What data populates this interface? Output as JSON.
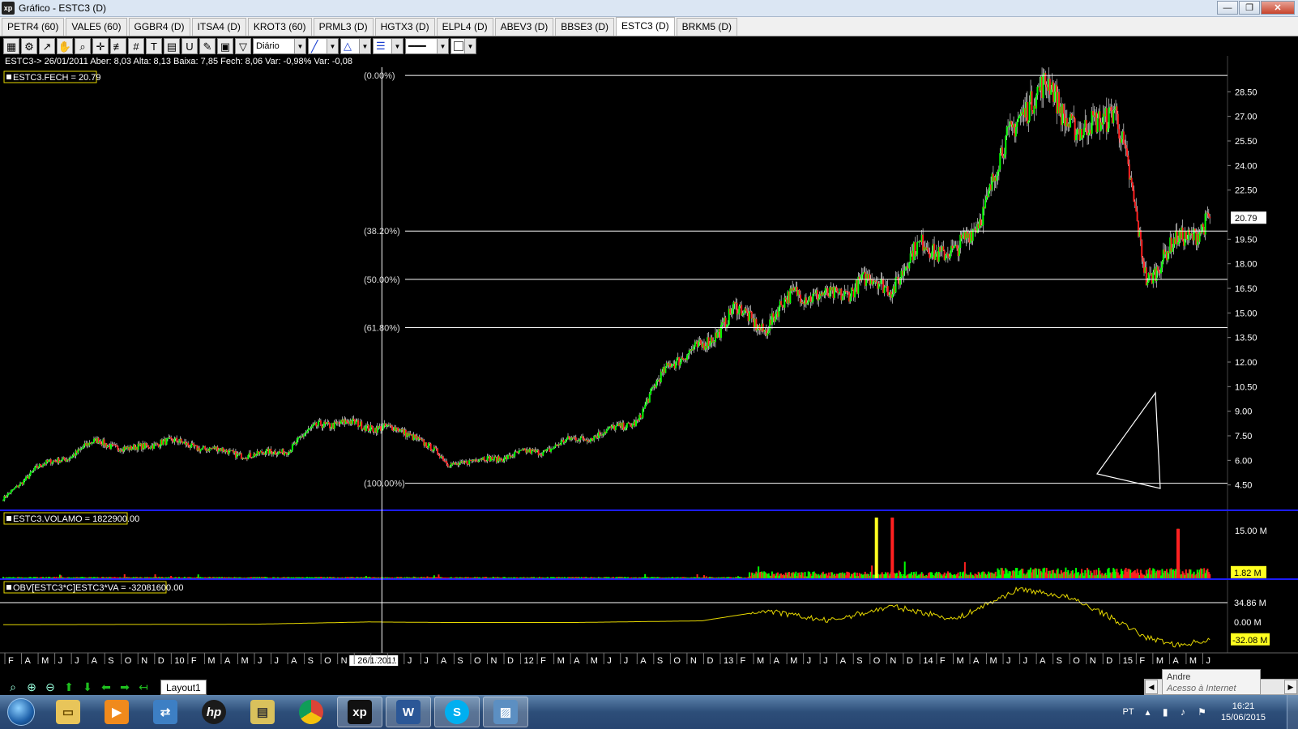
{
  "window": {
    "title": "Gráfico - ESTC3 (D)",
    "app_icon": "xp",
    "controls": [
      "minimize-icon",
      "restore-icon",
      "close-icon"
    ]
  },
  "tabs": [
    {
      "label": "PETR4 (60)",
      "active": false
    },
    {
      "label": "VALE5 (60)",
      "active": false
    },
    {
      "label": "GGBR4 (D)",
      "active": false
    },
    {
      "label": "ITSA4 (D)",
      "active": false
    },
    {
      "label": "KROT3 (60)",
      "active": false
    },
    {
      "label": "PRML3 (D)",
      "active": false
    },
    {
      "label": "HGTX3 (D)",
      "active": false
    },
    {
      "label": "ELPL4 (D)",
      "active": false
    },
    {
      "label": "ABEV3 (D)",
      "active": false
    },
    {
      "label": "BBSE3 (D)",
      "active": false
    },
    {
      "label": "ESTC3 (D)",
      "active": true
    },
    {
      "label": "BRKM5 (D)",
      "active": false
    }
  ],
  "toolbar": {
    "tools": [
      "chart-icon",
      "gear-icon",
      "trend-icon",
      "hand-icon",
      "zoom-icon",
      "crosshair-icon",
      "fibonacci-icon",
      "grid-icon",
      "text-icon",
      "calculator-icon",
      "magnet-icon",
      "brush-icon",
      "clipboard-icon",
      "filter-icon"
    ],
    "periodicity": "Diário",
    "line_style_icon": "diagonal-line-icon",
    "shape_icon": "triangle-icon",
    "fill_icon": "lines-icon",
    "stroke_icon": "solid-line-icon",
    "color_icon": "white-box-icon"
  },
  "info_line": "ESTC3-> 26/01/2011 Aber: 8,03 Alta: 8,13 Baixa: 7,85 Fech: 8,06 Var: -0,98% Var: -0,08",
  "price_panel": {
    "legend": "ESTC3.FECH = 20.79",
    "last_price_tag": "20.79",
    "y_ticks": [
      "28.50",
      "27.00",
      "25.50",
      "24.00",
      "22.50",
      "19.50",
      "18.00",
      "16.50",
      "15.00",
      "13.50",
      "12.00",
      "10.50",
      "9.00",
      "7.50",
      "6.00",
      "4.50"
    ],
    "fibonacci_levels": [
      {
        "label": "(0.00%)",
        "price": 29.5
      },
      {
        "label": "(38.20%)",
        "price": 20.0
      },
      {
        "label": "(50.00%)",
        "price": 17.05
      },
      {
        "label": "(61.80%)",
        "price": 14.1
      },
      {
        "label": "(100.00%)",
        "price": 4.6
      }
    ]
  },
  "volume_panel": {
    "legend": "ESTC3.VOLAMO = 1822900.00",
    "y_ticks": [
      "15.00 M"
    ],
    "last_value_tag": "1.82 M"
  },
  "obv_panel": {
    "legend": "OBV[ESTC3*C]ESTC3*VA = -32081600.00",
    "y_ticks": [
      "34.86 M",
      "0.00 M"
    ],
    "last_value_tag": "-32.08 M"
  },
  "x_axis": {
    "labels": [
      "F",
      "A",
      "M",
      "J",
      "J",
      "A",
      "S",
      "O",
      "N",
      "D",
      "10",
      "F",
      "M",
      "A",
      "M",
      "J",
      "J",
      "A",
      "S",
      "O",
      "N",
      "26/1/2011",
      "A",
      "M",
      "J",
      "J",
      "A",
      "S",
      "O",
      "N",
      "D",
      "12",
      "F",
      "M",
      "A",
      "M",
      "J",
      "J",
      "A",
      "S",
      "O",
      "N",
      "D",
      "13",
      "F",
      "M",
      "A",
      "M",
      "J",
      "J",
      "A",
      "S",
      "O",
      "N",
      "D",
      "14",
      "F",
      "M",
      "A",
      "M",
      "J",
      "J",
      "A",
      "S",
      "O",
      "N",
      "D",
      "15",
      "F",
      "M",
      "A",
      "M",
      "J"
    ],
    "cursor_label": "26/1/2011"
  },
  "chart_data": {
    "type": "line",
    "symbol": "ESTC3",
    "periodicity": "daily",
    "x_range": [
      "2009-02",
      "2015-06"
    ],
    "ylim": [
      3.0,
      30.0
    ],
    "price_scale": "linear",
    "close_series": {
      "name": "ESTC3.FECH",
      "x": [
        "2009-02",
        "2009-04",
        "2009-06",
        "2009-08",
        "2009-10",
        "2009-12",
        "2010-02",
        "2010-04",
        "2010-06",
        "2010-08",
        "2010-10",
        "2010-12",
        "2011-02",
        "2011-04",
        "2011-06",
        "2011-08",
        "2011-10",
        "2011-12",
        "2012-02",
        "2012-04",
        "2012-06",
        "2012-08",
        "2012-10",
        "2012-12",
        "2013-02",
        "2013-04",
        "2013-06",
        "2013-08",
        "2013-10",
        "2013-12",
        "2014-02",
        "2014-04",
        "2014-06",
        "2014-08",
        "2014-10",
        "2014-12",
        "2015-02",
        "2015-04",
        "2015-06"
      ],
      "values": [
        3.6,
        5.5,
        6.2,
        7.2,
        6.6,
        7.2,
        6.9,
        6.5,
        6.3,
        6.7,
        8.3,
        8.2,
        8.0,
        7.5,
        5.8,
        6.0,
        6.3,
        6.6,
        7.3,
        7.7,
        8.5,
        12.1,
        12.8,
        15.2,
        14.1,
        16.4,
        15.8,
        16.9,
        16.7,
        19.3,
        18.4,
        22.0,
        27.5,
        28.7,
        25.6,
        27.9,
        17.2,
        19.3,
        20.79
      ]
    },
    "volume_series": {
      "name": "ESTC3.VOLAMO",
      "unit": "M",
      "last": 1.8229,
      "notable_spikes": [
        {
          "x": "2013-09",
          "value": 19.0
        },
        {
          "x": "2013-10",
          "value": 19.0
        },
        {
          "x": "2015-04",
          "value": 15.5
        }
      ]
    },
    "obv_series": {
      "name": "OBV[ESTC3*C]ESTC3*VA",
      "unit": "M",
      "x": [
        "2009-02",
        "2010-06",
        "2011-01",
        "2011-06",
        "2012-02",
        "2012-10",
        "2013-02",
        "2013-06",
        "2013-10",
        "2014-02",
        "2014-06",
        "2014-09",
        "2014-11",
        "2015-02",
        "2015-04",
        "2015-06"
      ],
      "values": [
        -5,
        -4,
        0,
        -1,
        -1,
        2,
        20,
        2,
        28,
        5,
        60,
        45,
        20,
        -28,
        -42,
        -32.08
      ]
    },
    "annotations": [
      {
        "type": "fibonacci_retracement",
        "from_price": 4.6,
        "to_price": 29.5
      },
      {
        "type": "triangle"
      },
      {
        "type": "crosshair",
        "date": "26/01/2011"
      }
    ]
  },
  "bottom_bar": {
    "tools": [
      "zoom-fit-icon",
      "zoom-in-icon",
      "zoom-out-icon",
      "arrow-up-icon",
      "arrow-down-icon",
      "arrow-left-icon",
      "arrow-right-icon",
      "arrow-back-icon"
    ],
    "layout_tab": "Layout1",
    "tooltip_name": "Andre",
    "tooltip_status": "Acesso à Internet"
  },
  "taskbar": {
    "apps": [
      "explorer-icon",
      "media-player-icon",
      "network-icon",
      "hp-icon",
      "scanner-icon",
      "chrome-icon",
      "xp-icon",
      "word-icon",
      "skype-icon",
      "photos-icon"
    ],
    "active_app": "xp-icon",
    "language": "PT",
    "time": "16:21",
    "date": "15/06/2015"
  },
  "colors": {
    "background": "#000000",
    "up_candle": "#00ff00",
    "down_candle": "#ff2020",
    "obv_line": "#e6d800",
    "legend_border": "#e6d800",
    "panel_separator": "#1c1cff",
    "fib_line": "#ffffff"
  }
}
